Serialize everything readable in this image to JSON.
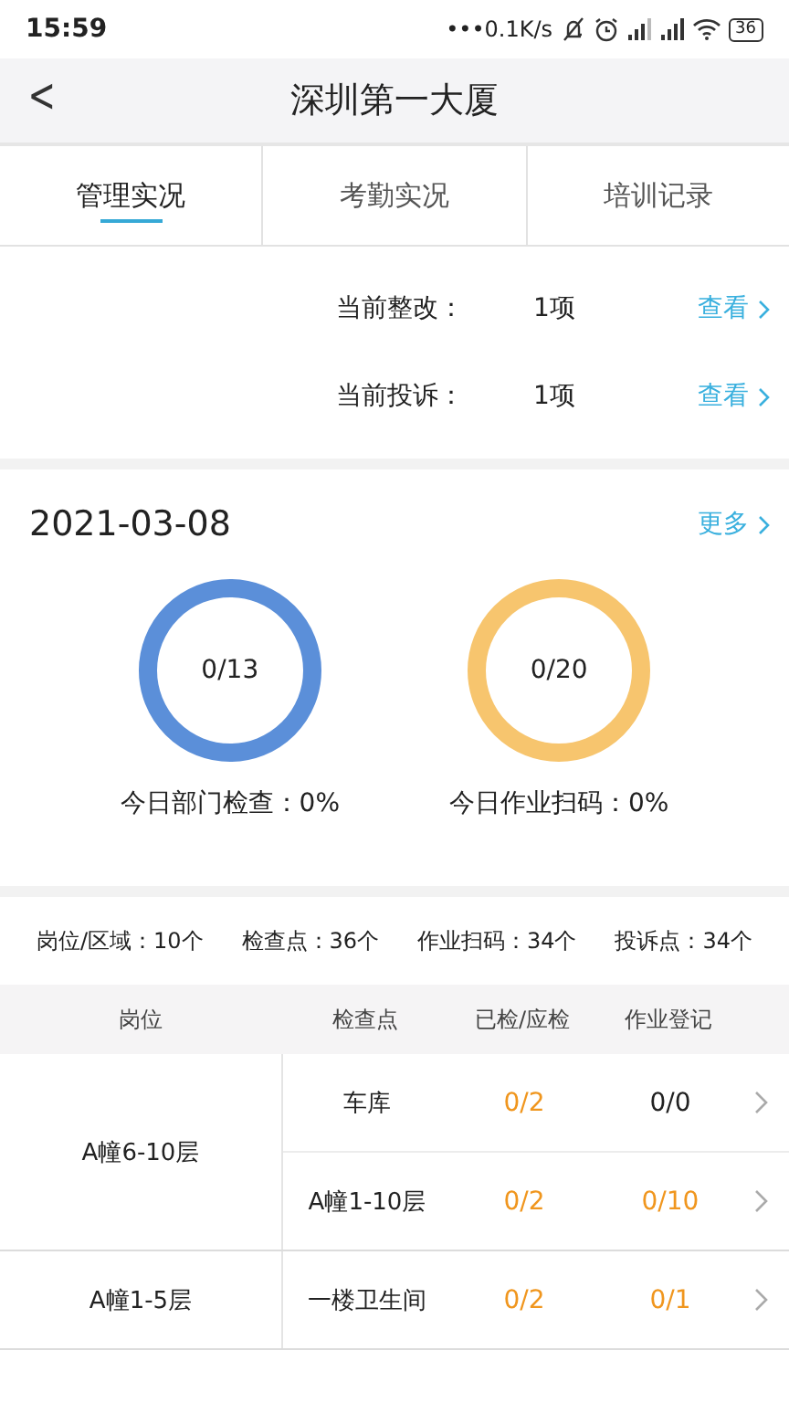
{
  "status_bar": {
    "time": "15:59",
    "speed": "•••0.1K/s",
    "battery": "36"
  },
  "header": {
    "back": "<",
    "title": "深圳第一大厦"
  },
  "tabs": [
    {
      "label": "管理实况",
      "selected": true
    },
    {
      "label": "考勤实况",
      "selected": false
    },
    {
      "label": "培训记录",
      "selected": false
    }
  ],
  "issues": [
    {
      "label": "当前整改：",
      "count": "1项",
      "link": "查看"
    },
    {
      "label": "当前投诉：",
      "count": "1项",
      "link": "查看"
    }
  ],
  "daily": {
    "date": "2021-03-08",
    "more": "更多",
    "rings": [
      {
        "value": "0/13",
        "caption": "今日部门检查：0%",
        "color": "#5b8fd9"
      },
      {
        "value": "0/20",
        "caption": "今日作业扫码：0%",
        "color": "#f7c56e"
      }
    ]
  },
  "summary": [
    "岗位/区域：10个",
    "检查点：36个",
    "作业扫码：34个",
    "投诉点：34个"
  ],
  "table": {
    "columns": [
      "岗位",
      "检查点",
      "已检/应检",
      "作业登记"
    ],
    "rows": [
      {
        "post": "A幢6-10层",
        "points": [
          {
            "name": "车库",
            "checked": {
              "text": "0/2",
              "color": "#f0961e"
            },
            "logged": {
              "text": "0/0",
              "color": "#222222"
            }
          },
          {
            "name": "A幢1-10层",
            "checked": {
              "text": "0/2",
              "color": "#f0961e"
            },
            "logged": {
              "text": "0/10",
              "color": "#f0961e"
            }
          }
        ]
      },
      {
        "post": "A幢1-5层",
        "points": [
          {
            "name": "一楼卫生间",
            "checked": {
              "text": "0/2",
              "color": "#f0961e"
            },
            "logged": {
              "text": "0/1",
              "color": "#f0961e"
            }
          }
        ]
      }
    ]
  }
}
